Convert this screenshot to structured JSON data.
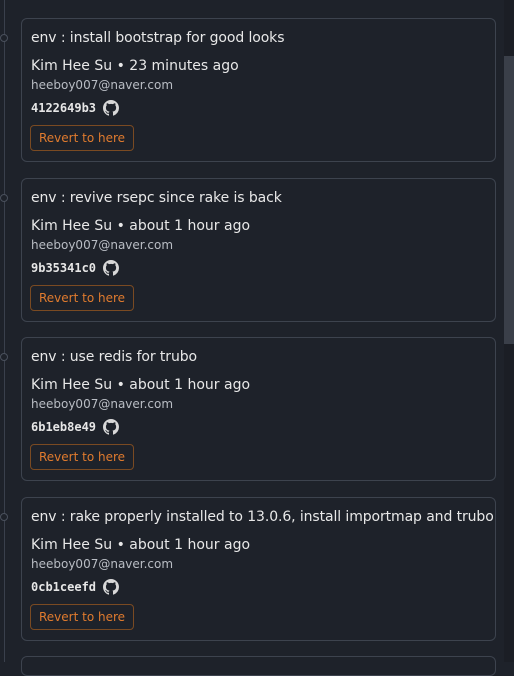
{
  "commits": [
    {
      "message": "env : install bootstrap for good looks",
      "author_line": "Kim Hee Su • 23 minutes ago",
      "email": "heeboy007@naver.com",
      "hash": "4122649b3",
      "github_icon": "github-icon",
      "revert_label": "Revert to here"
    },
    {
      "message": "env : revive rsepc since rake is back",
      "author_line": "Kim Hee Su • about 1 hour ago",
      "email": "heeboy007@naver.com",
      "hash": "9b35341c0",
      "github_icon": "github-icon",
      "revert_label": "Revert to here"
    },
    {
      "message": "env : use redis for trubo",
      "author_line": "Kim Hee Su • about 1 hour ago",
      "email": "heeboy007@naver.com",
      "hash": "6b1eb8e49",
      "github_icon": "github-icon",
      "revert_label": "Revert to here"
    },
    {
      "message": "env : rake properly installed to 13.0.6, install importmap and trubo",
      "author_line": "Kim Hee Su • about 1 hour ago",
      "email": "heeboy007@naver.com",
      "hash": "0cb1ceefd",
      "github_icon": "github-icon",
      "revert_label": "Revert to here"
    }
  ],
  "colors": {
    "background": "#1e222a",
    "card_border": "#3d434e",
    "revert_text": "#e07b2e",
    "revert_border": "#7a4a22"
  }
}
